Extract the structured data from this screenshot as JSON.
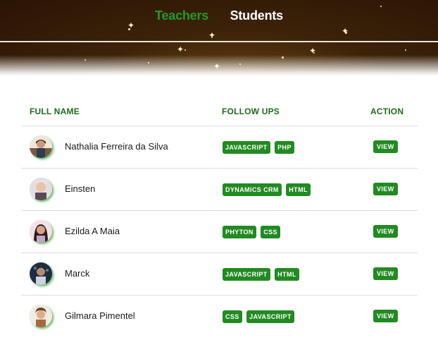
{
  "nav": {
    "tabs": [
      {
        "label": "Teachers",
        "active": true
      },
      {
        "label": "Students",
        "active": false
      }
    ]
  },
  "table": {
    "headers": {
      "name": "FULL NAME",
      "follow_ups": "FOLLOW UPS",
      "action": "ACTION"
    },
    "rows": [
      {
        "name": "Nathalia Ferreira da Silva",
        "tags": [
          "JAVASCRIPT",
          "PHP"
        ],
        "action": "VIEW"
      },
      {
        "name": "Einsten",
        "tags": [
          "DYNAMICS CRM",
          "HTML"
        ],
        "action": "VIEW"
      },
      {
        "name": "Ezilda A Maia",
        "tags": [
          "PHYTON",
          "CSS"
        ],
        "action": "VIEW"
      },
      {
        "name": "Marck",
        "tags": [
          "JAVASCRIPT",
          "HTML"
        ],
        "action": "VIEW"
      },
      {
        "name": "Gilmara Pimentel",
        "tags": [
          "CSS",
          "JAVASCRIPT"
        ],
        "action": "VIEW"
      }
    ]
  },
  "colors": {
    "accent_green": "#228a22",
    "active_tab": "#259a25",
    "header_text": "#1e6b1e",
    "banner_dark": "#2a1405"
  }
}
